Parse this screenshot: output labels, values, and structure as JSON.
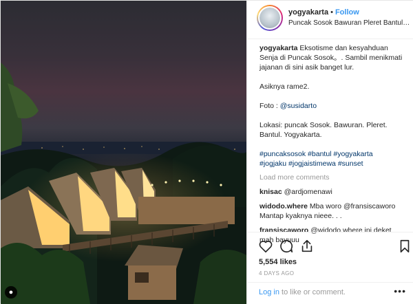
{
  "post": {
    "author": "yogyakarta",
    "separator": "•",
    "follow_label": "Follow",
    "location": "Puncak Sosok Bawuran Pleret Bantul Yogyakarta",
    "caption_author": "yogyakarta",
    "caption_lines": [
      "Eksotisme dan kesyahduan",
      "Senja di Puncak Sosok。. Sambil menikmati",
      "jajanan di sini asik banget lur."
    ],
    "caption_line2": "Asiknya rame2.",
    "photo_credit_label": "Foto : ",
    "photo_credit_user": "@susidarto",
    "location_label_lines": [
      "Lokasi: puncak Sosok. Bawuran. Pleret.",
      "Bantul. Yogyakarta."
    ],
    "hashtag_lines": [
      "#puncaksosok #bantul #yogyakarta",
      "#jogjaku #jogjaistimewa #sunset"
    ],
    "load_more_label": "Load more comments",
    "likes_label": "5,554 likes",
    "time_ago": "4 DAYS AGO",
    "login_link": "Log in",
    "login_text": " to like or comment.",
    "more_label": "•••",
    "user_tag_icon": "person-icon"
  },
  "comments": [
    {
      "user": "knisac",
      "text": " @ardjomenawi"
    },
    {
      "user": "widodo.where",
      "text": " Mba woro @fransiscaworo",
      "text2": "Mantap kyaknya nieee. . ."
    },
    {
      "user": "fransiscaworo",
      "text": " @widodo.where ini deket",
      "text2": "mah bayuuu"
    }
  ],
  "colors": {
    "accent": "#3897f0",
    "text": "#262626",
    "muted": "#999999",
    "link": "#003569"
  }
}
